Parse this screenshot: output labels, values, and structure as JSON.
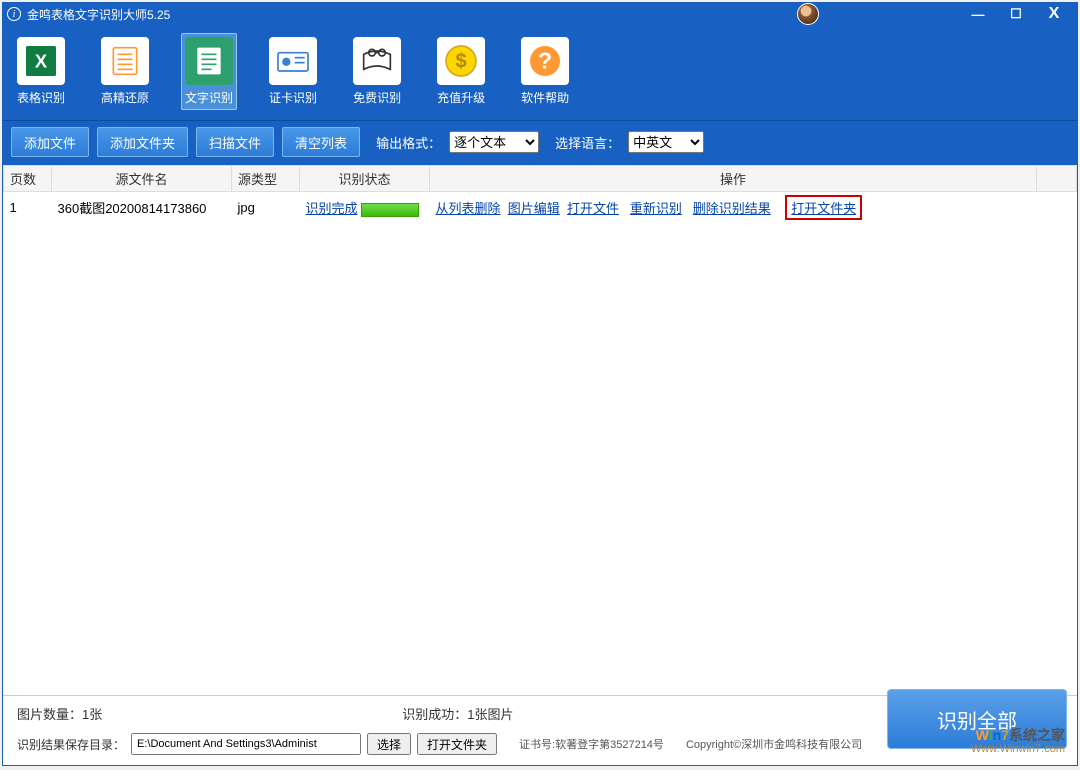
{
  "titlebar": {
    "title": "金鸣表格文字识别大师5.25"
  },
  "toolbar": {
    "items": [
      {
        "label": "表格识别"
      },
      {
        "label": "高精还原"
      },
      {
        "label": "文字识别"
      },
      {
        "label": "证卡识别"
      },
      {
        "label": "免费识别"
      },
      {
        "label": "充值升级"
      },
      {
        "label": "软件帮助"
      }
    ],
    "active_index": 2
  },
  "secondary": {
    "add_file": "添加文件",
    "add_folder": "添加文件夹",
    "scan_file": "扫描文件",
    "clear_list": "清空列表",
    "output_format_label": "输出格式：",
    "output_format_value": "逐个文本",
    "select_lang_label": "选择语言：",
    "select_lang_value": "中英文"
  },
  "table": {
    "headers": {
      "page": "页数",
      "src": "源文件名",
      "type": "源类型",
      "status": "识别状态",
      "ops": "操作"
    },
    "row": {
      "page": "1",
      "src": "360截图20200814173860",
      "type": "jpg",
      "status": "识别完成",
      "op_remove": "从列表删除",
      "op_edit": "图片编辑",
      "op_open": "打开文件",
      "op_rerec": "重新识别",
      "op_delres": "删除识别结果",
      "op_openfolder": "打开文件夹"
    }
  },
  "status": {
    "pic_count": "图片数量：1张",
    "success": "识别成功：1张图片",
    "save_dir_label": "识别结果保存目录：",
    "path": "E:\\Document And Settings3\\Administ",
    "choose": "选择",
    "open_folder": "打开文件夹",
    "cert": "证书号:软著登字第3527214号",
    "copyright": "Copyright©深圳市金鸣科技有限公司",
    "recognize_all": "识别全部"
  },
  "watermark": {
    "line1": "Win7系统之家",
    "line2": "Www.Winwin7.com"
  }
}
